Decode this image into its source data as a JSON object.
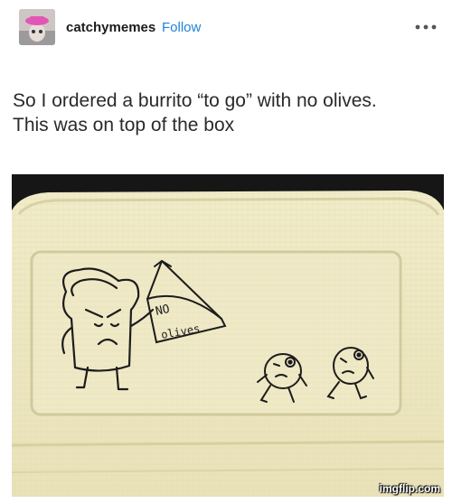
{
  "post": {
    "username": "catchymemes",
    "follow_label": "Follow",
    "more_icon": "more-horizontal-icon",
    "caption_line1": "So I ordered a burrito “to go” with no olives.",
    "caption_line2": "This was on top of the box"
  },
  "photo": {
    "sign_line1": "NO",
    "sign_line2": "olives",
    "watermark": "imgflip.com"
  },
  "colors": {
    "follow": "#1f83d6",
    "box": "#eee8c2",
    "ink": "#1c1c1c"
  }
}
